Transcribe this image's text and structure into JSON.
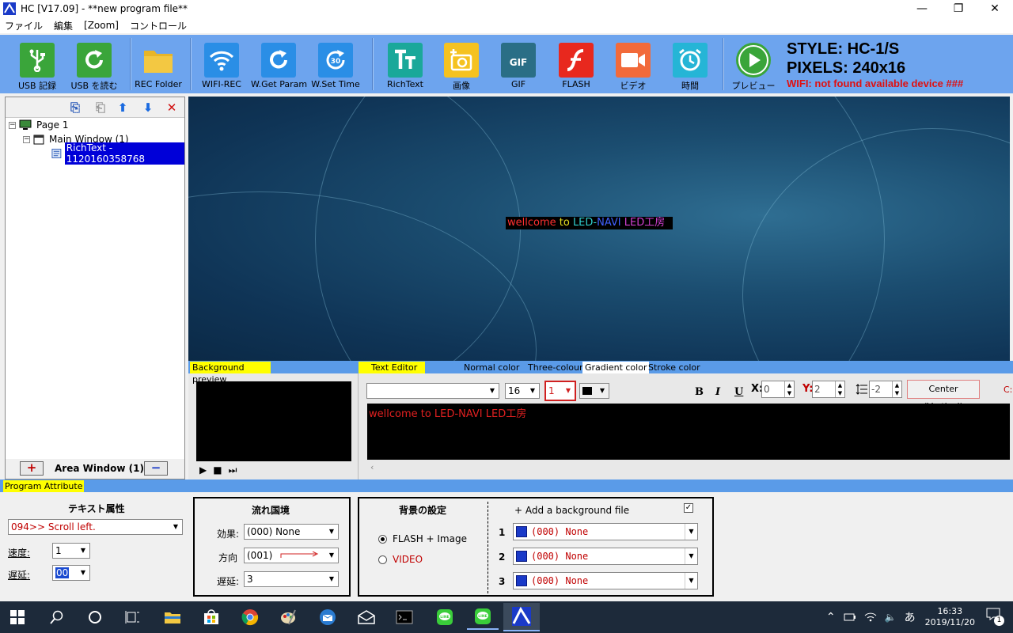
{
  "window": {
    "title": "HC [V17.09]  -   **new program file**",
    "minimize": "—",
    "maximize": "❐",
    "close": "✕"
  },
  "menu": [
    "ファイル",
    "編集",
    "[Zoom]",
    "コントロール"
  ],
  "toolbar": {
    "buttons": [
      {
        "label": "USB 記録",
        "icon": "usb-icon",
        "color": "#3aa53a"
      },
      {
        "label": "USB を読む",
        "icon": "refresh-icon",
        "color": "#3aa53a"
      },
      {
        "label": "REC Folder",
        "icon": "folder-icon",
        "color": "#e8b528"
      },
      {
        "label": "WIFI-REC",
        "icon": "wifi-icon",
        "color": "#2a8ee6"
      },
      {
        "label": "W.Get Param",
        "icon": "refresh-icon",
        "color": "#2a8ee6"
      },
      {
        "label": "W.Set Time",
        "icon": "timer-30-icon",
        "color": "#2a8ee6"
      },
      {
        "label": "RichText",
        "icon": "richtext-icon",
        "color": "#1aa89a"
      },
      {
        "label": "画像",
        "icon": "add-photo-icon",
        "color": "#f5c220"
      },
      {
        "label": "GIF",
        "icon": "gif-file-icon",
        "color": "#2a6e86"
      },
      {
        "label": "FLASH",
        "icon": "flash-icon",
        "color": "#e8281e"
      },
      {
        "label": "ビデオ",
        "icon": "video-camera-icon",
        "color": "#f26a3a"
      },
      {
        "label": "時間",
        "icon": "alarm-clock-icon",
        "color": "#25b5d6"
      },
      {
        "label": "プレビュー",
        "icon": "play-icon",
        "color": "#3aa53a"
      }
    ],
    "style_line": "STYLE: HC-1/S",
    "pixels_line": "PIXELS: 240x16",
    "wifi_line": "WIFI:   not found available device ###"
  },
  "tree": {
    "page": "Page 1",
    "main_window": "Main Window  (1)",
    "item": "RichText - 1120160358768"
  },
  "area_window": {
    "label": "Area Window (1)",
    "add": "+",
    "remove": "−"
  },
  "preview": {
    "led_segments": [
      {
        "text": "wellcome ",
        "color": "#ff3030"
      },
      {
        "text": "to ",
        "color": "#e8e020"
      },
      {
        "text": "LED-",
        "color": "#30d0d0"
      },
      {
        "text": "NAVI ",
        "color": "#4060ff"
      },
      {
        "text": " LED工房",
        "color": "#d040d0"
      }
    ]
  },
  "editor": {
    "bg_preview_tab": "Background preview",
    "text_editor_tab": "Text Editor",
    "color_tabs": [
      "Normal color",
      "Three-colour",
      "Gradient color",
      "Stroke color"
    ],
    "active_color_tab": "Gradient color",
    "font_name": "",
    "font_size": "16",
    "gradient_value": "1",
    "bold": "B",
    "italic": "I",
    "underline": "U",
    "x_label": "X:",
    "x_value": "0",
    "y_label": "Y:",
    "y_value": "2",
    "spacing_value": "-2",
    "center_button": "Center (Vertical)",
    "overflow_label": "C:",
    "text_content": "wellcome to LED-NAVI  LED工房",
    "play": "▶",
    "stop": "■",
    "next": "⏭"
  },
  "program_attribute": {
    "tab": "Program Attribute",
    "text_attr": {
      "title": "テキスト属性",
      "effect": "094>> Scroll left.",
      "speed_label": "速度:",
      "speed_value": "1",
      "delay_label": "遅延:",
      "delay_value": "00"
    },
    "border": {
      "title": "流れ国境",
      "effect_label": "効果:",
      "effect_value": "(000)  None",
      "direction_label": "方向",
      "direction_value": "(001)",
      "delay_label": "遅延:",
      "delay_value": "3"
    },
    "background": {
      "title": "背景の設定",
      "add_label": "+ Add a background file",
      "checked": true,
      "radio_flash": "FLASH + Image",
      "radio_video": "VIDEO",
      "rows": [
        {
          "num": "1",
          "value": "(000) None"
        },
        {
          "num": "2",
          "value": "(000) None"
        },
        {
          "num": "3",
          "value": "(000) None"
        }
      ]
    }
  },
  "taskbar": {
    "ime": "あ",
    "time": "16:33",
    "date": "2019/11/20",
    "notifications": "1"
  }
}
